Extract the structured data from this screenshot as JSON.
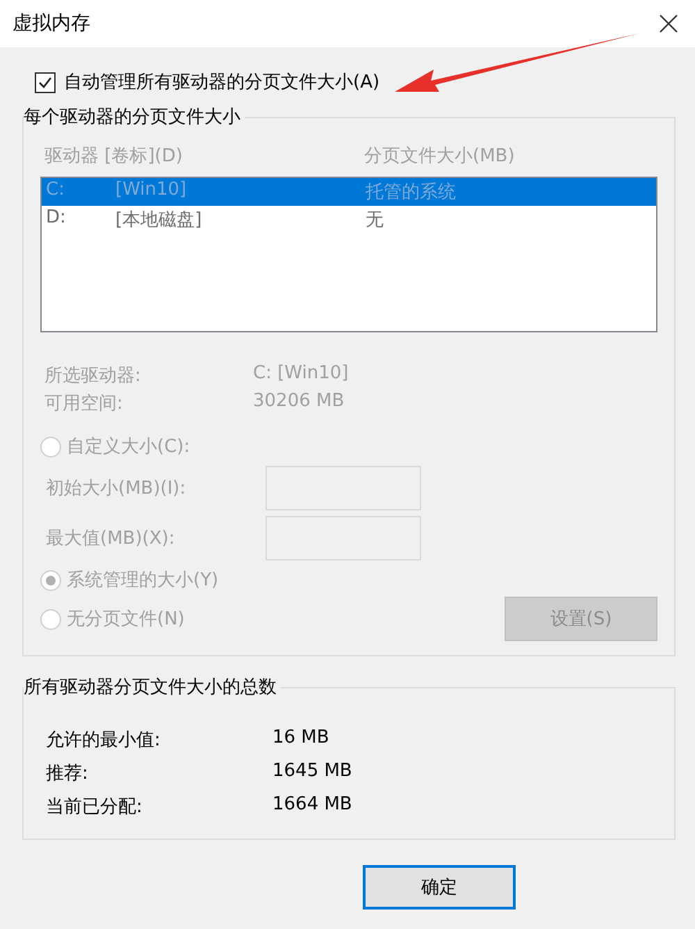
{
  "window": {
    "title": "虚拟内存"
  },
  "auto_manage": {
    "label": "自动管理所有驱动器的分页文件大小(A)",
    "checked": true
  },
  "per_drive": {
    "title": "每个驱动器的分页文件大小",
    "columns": [
      "驱动器 [卷标](D)",
      "分页文件大小(MB)"
    ],
    "rows": [
      {
        "drive": "C:",
        "label": "[Win10]",
        "size": "托管的系统",
        "selected": true
      },
      {
        "drive": "D:",
        "label": "[本地磁盘]",
        "size": "无",
        "selected": false
      }
    ],
    "info": [
      {
        "label": "所选驱动器:",
        "value": "C:  [Win10]"
      },
      {
        "label": "可用空间:",
        "value": "30206 MB"
      }
    ],
    "options": [
      {
        "kind": "custom",
        "label": "自定义大小(C):",
        "selected": false,
        "disabled": true,
        "fields": [
          {
            "label": "初始大小(MB)(I):",
            "disabled": true
          },
          {
            "label": "最大值(MB)(X):",
            "disabled": true
          }
        ]
      },
      {
        "kind": "radio",
        "label": "系统管理的大小(Y)",
        "selected": true,
        "disabled": true
      },
      {
        "kind": "radio",
        "label": "无分页文件(N)",
        "selected": false,
        "disabled": true
      }
    ],
    "set_button": {
      "label": "设置(S)",
      "disabled": true
    }
  },
  "totals": {
    "title": "所有驱动器分页文件大小的总数",
    "rows": [
      {
        "label": "允许的最小值:",
        "value": "16 MB"
      },
      {
        "label": "推荐:",
        "value": "1645 MB"
      },
      {
        "label": "当前已分配:",
        "value": "1664 MB"
      }
    ]
  },
  "buttons": [
    {
      "label": "确定"
    }
  ]
}
